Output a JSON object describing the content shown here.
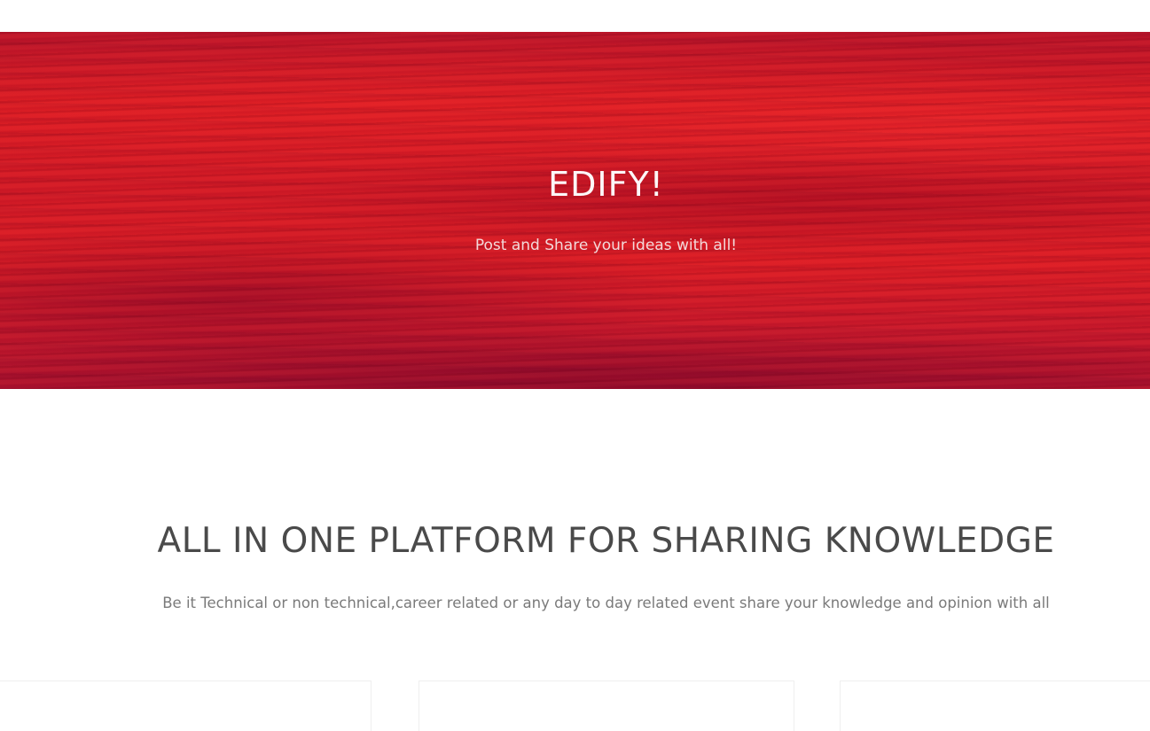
{
  "hero": {
    "title": "EDIFY!",
    "subtitle": "Post and Share your ideas with all!"
  },
  "section": {
    "title": "ALL IN ONE PLATFORM FOR SHARING KNOWLEDGE",
    "text": "Be it Technical or non technical,career related or any day to day related event share your knowledge and opinion with all"
  },
  "colors": {
    "hero_red": "#d81c24",
    "heading_gray": "#4a4a4a",
    "text_gray": "#7a7a7a"
  }
}
